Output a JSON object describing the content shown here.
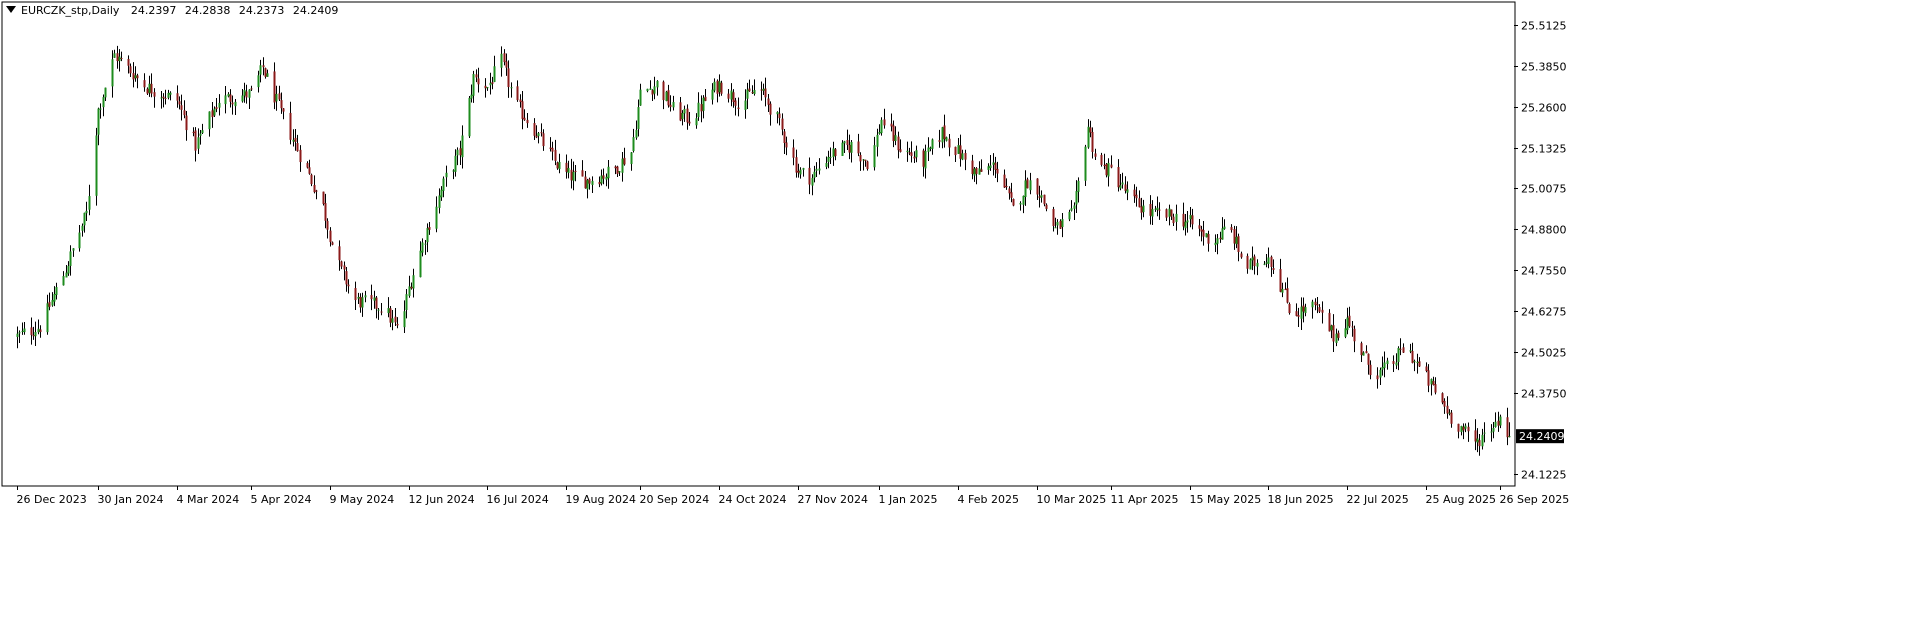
{
  "header": {
    "symbol": "EURCZK_stp,Daily",
    "open": "24.2397",
    "high": "24.2838",
    "low": "24.2373",
    "close": "24.2409"
  },
  "colors": {
    "bull": "#1e8c1e",
    "bear": "#8b1a1a",
    "wick": "#000000",
    "frame": "#000000",
    "price_tag_bg": "#000000",
    "price_tag_fg": "#ffffff",
    "background": "#ffffff"
  },
  "chart_data": {
    "type": "candlestick",
    "title": "EURCZK_stp,Daily",
    "current_price": "24.2409",
    "x_tick_labels": [
      "26 Dec 2023",
      "30 Jan 2024",
      "4 Mar 2024",
      "5 Apr 2024",
      "9 May 2024",
      "12 Jun 2024",
      "16 Jul 2024",
      "19 Aug 2024",
      "20 Sep 2024",
      "24 Oct 2024",
      "27 Nov 2024",
      "1 Jan 2025",
      "4 Feb 2025",
      "10 Mar 2025",
      "11 Apr 2025",
      "15 May 2025",
      "18 Jun 2025",
      "22 Jul 2025",
      "25 Aug 2025",
      "26 Sep 2025"
    ],
    "y_tick_labels": [
      "25.5125",
      "25.3850",
      "25.2600",
      "25.1325",
      "25.0075",
      "24.8800",
      "24.7550",
      "24.6275",
      "24.5025",
      "24.3750",
      "24.1225"
    ],
    "y_ticks": [
      25.5125,
      25.385,
      25.26,
      25.1325,
      25.0075,
      24.88,
      24.755,
      24.6275,
      24.5025,
      24.375,
      24.1225
    ],
    "ylim": [
      24.09,
      25.58
    ],
    "series_anchors": [
      {
        "date": "2023-12-26",
        "close": 24.55
      },
      {
        "date": "2024-01-05",
        "close": 24.58
      },
      {
        "date": "2024-01-15",
        "close": 24.74
      },
      {
        "date": "2024-01-25",
        "close": 24.93
      },
      {
        "date": "2024-01-30",
        "close": 25.25
      },
      {
        "date": "2024-02-06",
        "close": 25.42
      },
      {
        "date": "2024-02-20",
        "close": 25.32
      },
      {
        "date": "2024-03-04",
        "close": 25.28
      },
      {
        "date": "2024-03-12",
        "close": 25.14
      },
      {
        "date": "2024-03-22",
        "close": 25.28
      },
      {
        "date": "2024-04-05",
        "close": 25.3
      },
      {
        "date": "2024-04-10",
        "close": 25.38
      },
      {
        "date": "2024-04-18",
        "close": 25.24
      },
      {
        "date": "2024-04-28",
        "close": 25.08
      },
      {
        "date": "2024-05-06",
        "close": 24.95
      },
      {
        "date": "2024-05-12",
        "close": 24.78
      },
      {
        "date": "2024-05-20",
        "close": 24.66
      },
      {
        "date": "2024-06-01",
        "close": 24.64
      },
      {
        "date": "2024-06-08",
        "close": 24.56
      },
      {
        "date": "2024-06-12",
        "close": 24.7
      },
      {
        "date": "2024-06-20",
        "close": 24.88
      },
      {
        "date": "2024-06-28",
        "close": 25.04
      },
      {
        "date": "2024-07-04",
        "close": 25.12
      },
      {
        "date": "2024-07-10",
        "close": 25.35
      },
      {
        "date": "2024-07-16",
        "close": 25.32
      },
      {
        "date": "2024-07-22",
        "close": 25.4
      },
      {
        "date": "2024-07-28",
        "close": 25.27
      },
      {
        "date": "2024-08-05",
        "close": 25.19
      },
      {
        "date": "2024-08-14",
        "close": 25.09
      },
      {
        "date": "2024-08-19",
        "close": 25.05
      },
      {
        "date": "2024-08-28",
        "close": 25.03
      },
      {
        "date": "2024-09-08",
        "close": 25.06
      },
      {
        "date": "2024-09-16",
        "close": 25.12
      },
      {
        "date": "2024-09-20",
        "close": 25.3
      },
      {
        "date": "2024-09-27",
        "close": 25.33
      },
      {
        "date": "2024-10-05",
        "close": 25.24
      },
      {
        "date": "2024-10-12",
        "close": 25.22
      },
      {
        "date": "2024-10-20",
        "close": 25.3
      },
      {
        "date": "2024-10-24",
        "close": 25.33
      },
      {
        "date": "2024-11-02",
        "close": 25.27
      },
      {
        "date": "2024-11-10",
        "close": 25.32
      },
      {
        "date": "2024-11-18",
        "close": 25.22
      },
      {
        "date": "2024-11-27",
        "close": 25.06
      },
      {
        "date": "2024-12-03",
        "close": 25.04
      },
      {
        "date": "2024-12-10",
        "close": 25.11
      },
      {
        "date": "2024-12-20",
        "close": 25.14
      },
      {
        "date": "2024-12-28",
        "close": 25.08
      },
      {
        "date": "2025-01-02",
        "close": 25.22
      },
      {
        "date": "2025-01-10",
        "close": 25.13
      },
      {
        "date": "2025-01-20",
        "close": 25.09
      },
      {
        "date": "2025-01-28",
        "close": 25.18
      },
      {
        "date": "2025-02-04",
        "close": 25.12
      },
      {
        "date": "2025-02-12",
        "close": 25.05
      },
      {
        "date": "2025-02-20",
        "close": 25.08
      },
      {
        "date": "2025-02-28",
        "close": 24.94
      },
      {
        "date": "2025-03-06",
        "close": 25.03
      },
      {
        "date": "2025-03-10",
        "close": 25.01
      },
      {
        "date": "2025-03-18",
        "close": 24.88
      },
      {
        "date": "2025-03-26",
        "close": 24.93
      },
      {
        "date": "2025-04-01",
        "close": 25.2
      },
      {
        "date": "2025-04-05",
        "close": 25.08
      },
      {
        "date": "2025-04-11",
        "close": 25.06
      },
      {
        "date": "2025-04-20",
        "close": 24.97
      },
      {
        "date": "2025-04-28",
        "close": 24.93
      },
      {
        "date": "2025-05-08",
        "close": 24.92
      },
      {
        "date": "2025-05-15",
        "close": 24.9
      },
      {
        "date": "2025-05-25",
        "close": 24.84
      },
      {
        "date": "2025-06-01",
        "close": 24.89
      },
      {
        "date": "2025-06-08",
        "close": 24.76
      },
      {
        "date": "2025-06-18",
        "close": 24.8
      },
      {
        "date": "2025-06-28",
        "close": 24.62
      },
      {
        "date": "2025-07-08",
        "close": 24.64
      },
      {
        "date": "2025-07-16",
        "close": 24.55
      },
      {
        "date": "2025-07-22",
        "close": 24.6
      },
      {
        "date": "2025-07-28",
        "close": 24.5
      },
      {
        "date": "2025-08-03",
        "close": 24.43
      },
      {
        "date": "2025-08-10",
        "close": 24.46
      },
      {
        "date": "2025-08-16",
        "close": 24.52
      },
      {
        "date": "2025-08-25",
        "close": 24.42
      },
      {
        "date": "2025-09-05",
        "close": 24.3
      },
      {
        "date": "2025-09-15",
        "close": 24.22
      },
      {
        "date": "2025-09-22",
        "close": 24.27
      },
      {
        "date": "2025-09-26",
        "close": 24.3
      },
      {
        "date": "2025-09-30",
        "close": 24.2409
      }
    ]
  }
}
